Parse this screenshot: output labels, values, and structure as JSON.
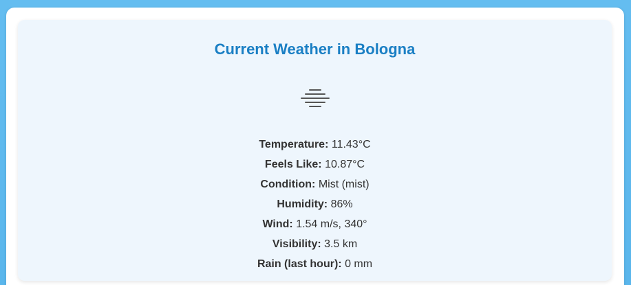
{
  "title": "Current Weather in Bologna",
  "icon": "mist-icon",
  "details": [
    {
      "label": "Temperature:",
      "value": "11.43°C"
    },
    {
      "label": "Feels Like:",
      "value": "10.87°C"
    },
    {
      "label": "Condition:",
      "value": "Mist (mist)"
    },
    {
      "label": "Humidity:",
      "value": "86%"
    },
    {
      "label": "Wind:",
      "value": "1.54 m/s, 340°"
    },
    {
      "label": "Visibility:",
      "value": "3.5 km"
    },
    {
      "label": "Rain (last hour):",
      "value": "0 mm"
    }
  ],
  "colors": {
    "title": "#1a7fc4",
    "text": "#333333",
    "panel": "#eef6fd",
    "background": "#64bdf0"
  }
}
